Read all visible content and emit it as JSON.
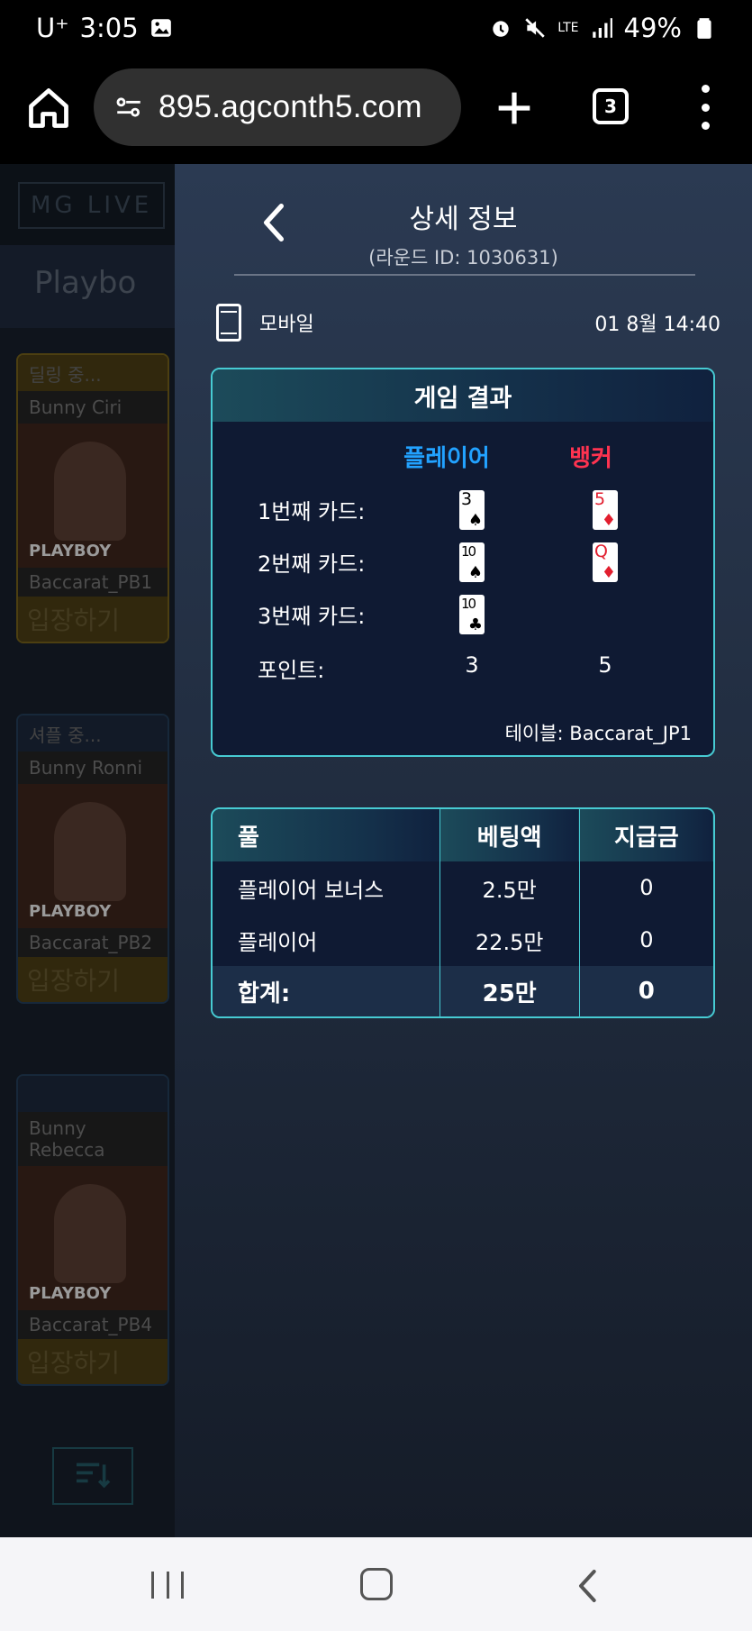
{
  "status_bar": {
    "carrier": "U⁺",
    "time": "3:05",
    "battery": "49%",
    "network": "LTE"
  },
  "browser": {
    "url": "895.agconth5.com",
    "tab_count": "3"
  },
  "background_app": {
    "logo": "MG LIVE",
    "provider": "Playbo",
    "cards": [
      {
        "status": "딜링 중...",
        "name": "Bunny Ciri",
        "brand": "PLAYBOY",
        "table": "Baccarat_PB1",
        "enter": "입장하기"
      },
      {
        "status": "셔플 중...",
        "name": "Bunny Ronni",
        "brand": "PLAYBOY",
        "table": "Baccarat_PB2",
        "enter": "입장하기"
      },
      {
        "status": "",
        "name": "Bunny Rebecca",
        "brand": "PLAYBOY",
        "table": "Baccarat_PB4",
        "enter": "입장하기"
      }
    ]
  },
  "panel": {
    "title": "상세 정보",
    "round_id": "(라운드 ID: 1030631)",
    "device": "모바일",
    "date": "01  8월 14:40",
    "result": {
      "header": "게임 결과",
      "player_label": "플레이어",
      "banker_label": "뱅커",
      "rows": [
        {
          "label": "1번째  카드:",
          "player_card": {
            "rank": "3",
            "suit": "♠",
            "color": "black"
          },
          "banker_card": {
            "rank": "5",
            "suit": "♦",
            "color": "red"
          }
        },
        {
          "label": "2번째 카드:",
          "player_card": {
            "rank": "10",
            "suit": "♠",
            "color": "black"
          },
          "banker_card": {
            "rank": "Q",
            "suit": "♦",
            "color": "red"
          }
        },
        {
          "label": "3번째 카드:",
          "player_card": {
            "rank": "10",
            "suit": "♣",
            "color": "black"
          },
          "banker_card": null
        }
      ],
      "points_label": "포인트:",
      "player_points": "3",
      "banker_points": "5",
      "table": "테이블: Baccarat_JP1"
    },
    "bets": {
      "headers": [
        "풀",
        "베팅액",
        "지급금"
      ],
      "rows": [
        [
          "플레이어 보너스",
          "2.5만",
          "0"
        ],
        [
          "플레이어",
          "22.5만",
          "0"
        ]
      ],
      "total": [
        "합계:",
        "25만",
        "0"
      ]
    }
  },
  "colors": {
    "accent_border": "#47cbd3",
    "player_blue": "#22a2ff",
    "banker_red": "#ff3350"
  }
}
